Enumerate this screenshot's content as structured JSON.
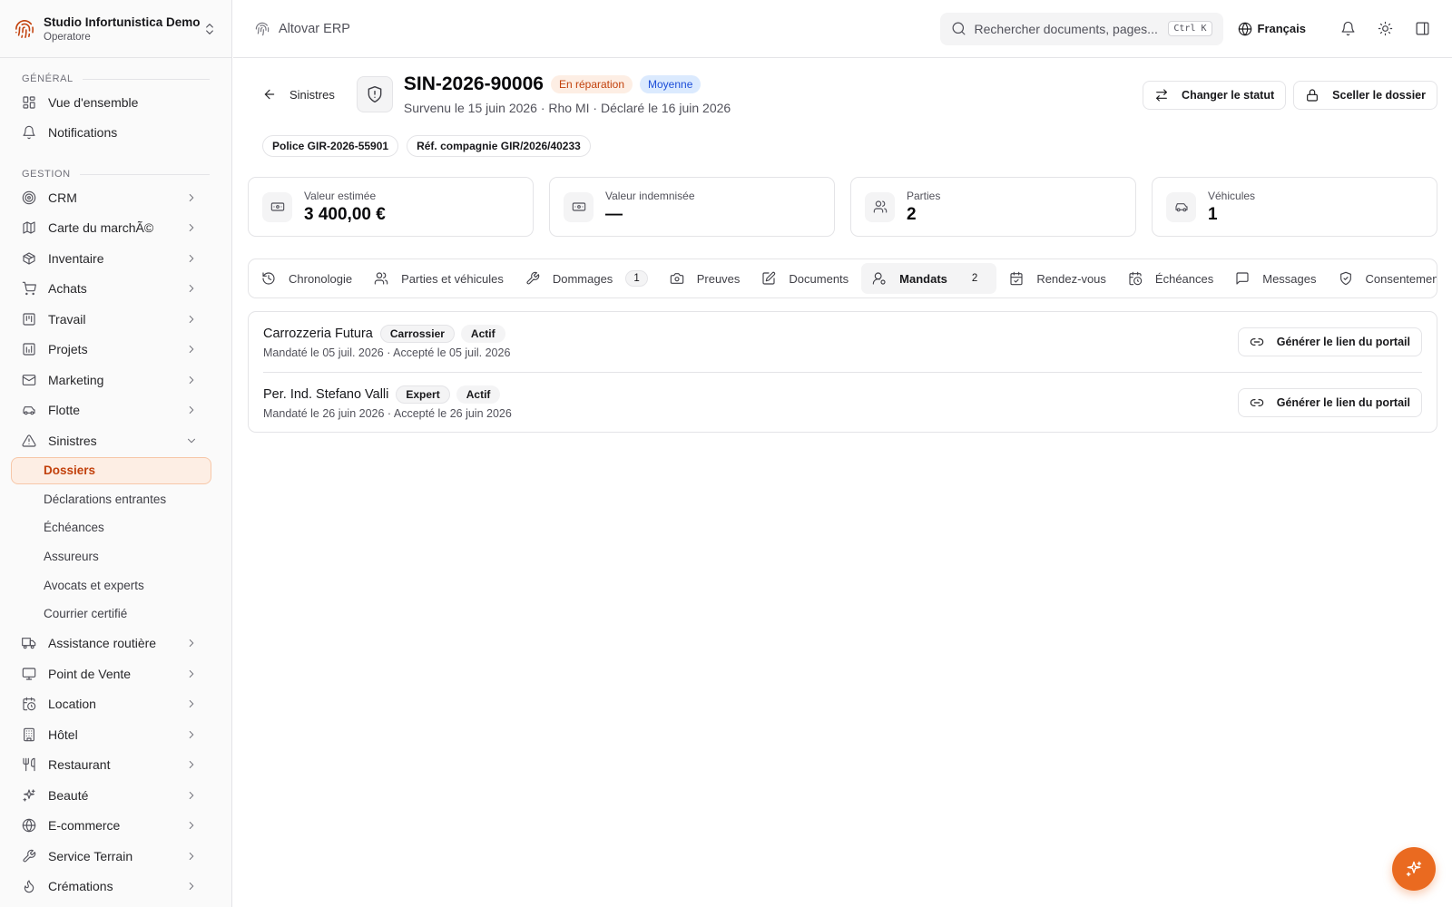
{
  "org": {
    "name": "Studio Infortunistica Demo",
    "role": "Operatore"
  },
  "sidebar": {
    "sections": [
      {
        "label": "GÉNÉRAL"
      },
      {
        "label": "GESTION"
      }
    ],
    "general": [
      {
        "label": "Vue d'ensemble",
        "icon": "dashboard-icon"
      },
      {
        "label": "Notifications",
        "icon": "bell-icon"
      }
    ],
    "gestion": [
      {
        "label": "CRM",
        "icon": "target-icon"
      },
      {
        "label": "Carte du marchÃ©",
        "icon": "map-icon"
      },
      {
        "label": "Inventaire",
        "icon": "package-icon"
      },
      {
        "label": "Achats",
        "icon": "cart-icon"
      },
      {
        "label": "Travail",
        "icon": "kanban-icon"
      },
      {
        "label": "Projets",
        "icon": "project-icon"
      },
      {
        "label": "Marketing",
        "icon": "mail-icon"
      },
      {
        "label": "Flotte",
        "icon": "car-icon"
      },
      {
        "label": "Sinistres",
        "icon": "warning-icon"
      }
    ],
    "sinistres_sub": [
      {
        "label": "Dossiers",
        "active": true
      },
      {
        "label": "Déclarations entrantes"
      },
      {
        "label": "Échéances"
      },
      {
        "label": "Assureurs"
      },
      {
        "label": "Avocats et experts"
      },
      {
        "label": "Courrier certifié"
      }
    ],
    "more": [
      {
        "label": "Assistance routière",
        "icon": "truck-icon"
      },
      {
        "label": "Point de Vente",
        "icon": "monitor-icon"
      },
      {
        "label": "Location",
        "icon": "calendar-clock-icon"
      },
      {
        "label": "Hôtel",
        "icon": "building-icon"
      },
      {
        "label": "Restaurant",
        "icon": "utensils-icon"
      },
      {
        "label": "Beauté",
        "icon": "sparkle-icon"
      },
      {
        "label": "E-commerce",
        "icon": "globe-icon"
      },
      {
        "label": "Service Terrain",
        "icon": "wrench-icon"
      },
      {
        "label": "Crémations",
        "icon": "flame-icon"
      }
    ]
  },
  "topbar": {
    "app_name": "Altovar ERP",
    "search_placeholder": "Rechercher documents, pages...",
    "shortcut": "Ctrl K",
    "language": "Français"
  },
  "claim": {
    "back_label": "Sinistres",
    "id": "SIN-2026-90006",
    "status_badge": "En réparation",
    "priority_badge": "Moyenne",
    "subtitle": "Survenu le 15 juin 2026 · Rho MI · Déclaré le 16 juin 2026",
    "actions": {
      "change_status": "Changer le statut",
      "seal": "Sceller le dossier"
    },
    "chips": [
      "Police GIR-2026-55901",
      "Réf. compagnie GIR/2026/40233"
    ]
  },
  "stats": [
    {
      "label": "Valeur estimée",
      "value": "3 400,00 €",
      "icon": "banknote-icon"
    },
    {
      "label": "Valeur indemnisée",
      "value": "—",
      "icon": "banknote-icon"
    },
    {
      "label": "Parties",
      "value": "2",
      "icon": "users-icon"
    },
    {
      "label": "Véhicules",
      "value": "1",
      "icon": "car-icon"
    }
  ],
  "tabs": [
    {
      "label": "Chronologie",
      "icon": "history-icon"
    },
    {
      "label": "Parties et véhicules",
      "icon": "users-icon"
    },
    {
      "label": "Dommages",
      "icon": "wrench-icon",
      "count": "1"
    },
    {
      "label": "Preuves",
      "icon": "camera-icon"
    },
    {
      "label": "Documents",
      "icon": "edit-icon"
    },
    {
      "label": "Mandats",
      "icon": "user-cog-icon",
      "count": "2",
      "active": true
    },
    {
      "label": "Rendez-vous",
      "icon": "calendar-check-icon"
    },
    {
      "label": "Échéances",
      "icon": "calendar-clock-icon"
    },
    {
      "label": "Messages",
      "icon": "message-icon"
    },
    {
      "label": "Consentements",
      "icon": "shield-check-icon"
    }
  ],
  "mandates": [
    {
      "name": "Carrozzeria Futura",
      "role": "Carrossier",
      "status": "Actif",
      "meta": "Mandaté le 05 juil. 2026 · Accepté le 05 juil. 2026",
      "action": "Générer le lien du portail"
    },
    {
      "name": "Per. Ind. Stefano Valli",
      "role": "Expert",
      "status": "Actif",
      "meta": "Mandaté le 26 juin 2026 · Accepté le 26 juin 2026",
      "action": "Générer le lien du portail"
    }
  ],
  "colors": {
    "accent": "#ea6a20",
    "accent_soft": "#fdeee4",
    "blue_badge": "#dbeafe"
  }
}
